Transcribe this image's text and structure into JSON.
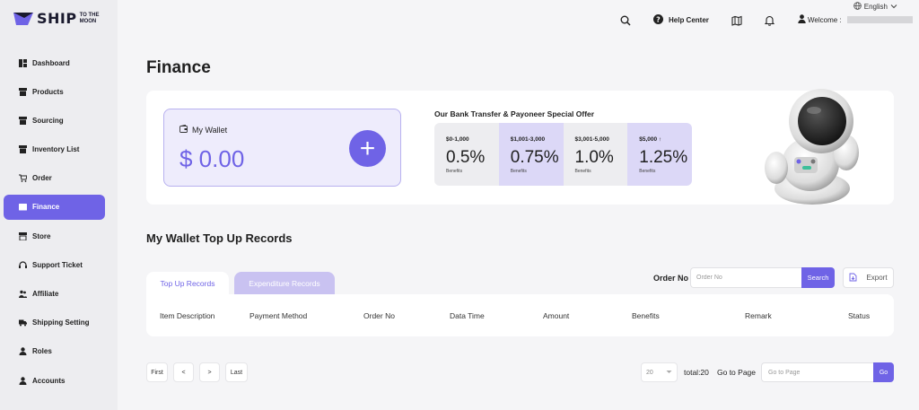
{
  "logo": {
    "brand": "SHIP",
    "sub": "TO THE MOON"
  },
  "sidebar": {
    "items": [
      {
        "label": "Dashboard",
        "icon": "dashboard-icon"
      },
      {
        "label": "Products",
        "icon": "box-icon"
      },
      {
        "label": "Sourcing",
        "icon": "box-icon"
      },
      {
        "label": "Inventory List",
        "icon": "box-icon"
      },
      {
        "label": "Order",
        "icon": "cart-icon"
      },
      {
        "label": "Finance",
        "icon": "wallet-icon",
        "active": true
      },
      {
        "label": "Store",
        "icon": "store-icon"
      },
      {
        "label": "Support Ticket",
        "icon": "headset-icon"
      },
      {
        "label": "Affiliate",
        "icon": "group-icon"
      },
      {
        "label": "Shipping Setting",
        "icon": "truck-icon"
      },
      {
        "label": "Roles",
        "icon": "user-icon"
      },
      {
        "label": "Accounts",
        "icon": "user-icon"
      }
    ]
  },
  "header": {
    "language": "English",
    "help_center": "Help Center",
    "welcome": "Welcome :"
  },
  "page": {
    "title": "Finance"
  },
  "wallet": {
    "label": "My Wallet",
    "balance": "$ 0.00",
    "add_symbol": "+"
  },
  "offer": {
    "title": "Our Bank Transfer & Payoneer Special Offer",
    "tiers": [
      {
        "range": "$0-1,000",
        "rate": "0.5%",
        "label": "Benefits"
      },
      {
        "range": "$1,001-3,000",
        "rate": "0.75%",
        "label": "Benefits"
      },
      {
        "range": "$3,001-5,000",
        "rate": "1.0%",
        "label": "Benefits"
      },
      {
        "range": "$5,000 ↑",
        "rate": "1.25%",
        "label": "Benefits"
      }
    ]
  },
  "records": {
    "title": "My Wallet Top Up Records",
    "tabs": {
      "topup": "Top Up Records",
      "expenditure": "Expenditure Records"
    },
    "order_label": "Order No",
    "order_placeholder": "Order No",
    "search_label": "Search",
    "export_label": "Export",
    "columns": [
      "Item Description",
      "Payment Method",
      "Order No",
      "Data Time",
      "Amount",
      "Benefits",
      "Remark",
      "Status"
    ]
  },
  "pagination": {
    "first": "First",
    "prev": "<",
    "next": ">",
    "last": "Last",
    "page_size": "20",
    "total": "total:20",
    "goto_label": "Go to Page",
    "goto_placeholder": "Go to Page",
    "go": "Go"
  },
  "colors": {
    "accent": "#6f63e6",
    "accent_light": "#eeecfc",
    "tier_purple": "#dcd8f7"
  }
}
